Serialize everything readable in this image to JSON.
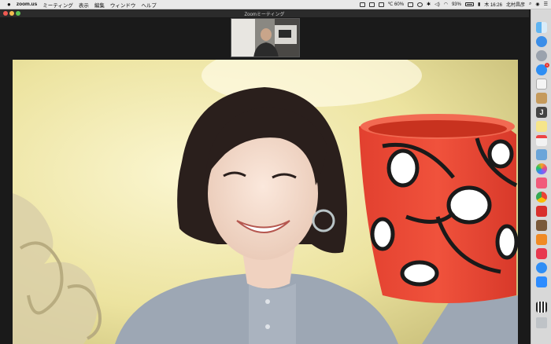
{
  "menubar": {
    "apple_icon": "apple-icon",
    "app_name": "zoom.us",
    "menus": [
      "ミーティング",
      "表示",
      "編集",
      "ウィンドウ",
      "ヘルプ"
    ],
    "status": {
      "temperature": "℃ 60%",
      "battery": "93%",
      "time": "木 16:26",
      "user": "北村昌彦"
    }
  },
  "zoom_window": {
    "title": "Zoomミーティング",
    "traffic_lights": {
      "close": "#ee5a52",
      "minimize": "#f5bd4f",
      "zoom": "#5fc553"
    }
  },
  "dock": {
    "icons": [
      "finder-icon",
      "safari-icon",
      "launchpad-icon",
      "app-store-icon",
      "notes-icon",
      "contacts-icon",
      "jedit-icon",
      "stickies-icon",
      "calendar-icon",
      "preview-icon",
      "photos-icon",
      "music-icon",
      "chrome-icon",
      "pdf-icon",
      "notebook-icon",
      "books-icon",
      "pocket-icon",
      "messages-icon",
      "zoom-icon",
      "qr-icon",
      "trash-icon"
    ],
    "app_store_badge": "1"
  }
}
